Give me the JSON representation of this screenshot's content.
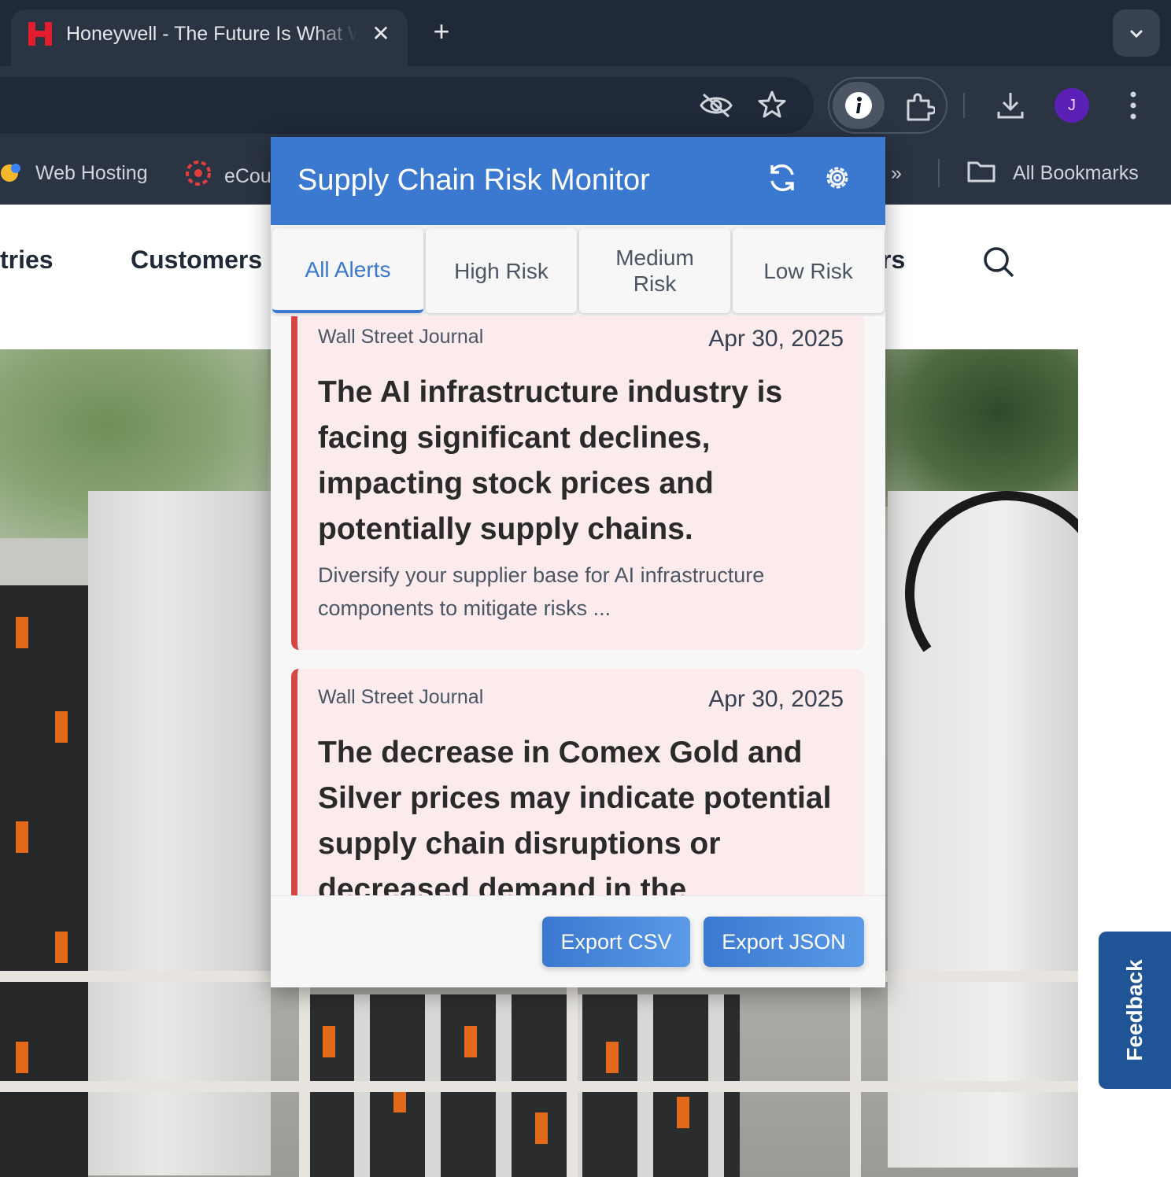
{
  "browser": {
    "tab_title": "Honeywell - The Future Is What We Make It",
    "favicon_letter": "H",
    "avatar_initial": "J",
    "bookmarks": [
      {
        "label": "Web Hosting"
      },
      {
        "label": "eCou"
      }
    ],
    "all_bookmarks_label": "All Bookmarks",
    "overflow_label": "»"
  },
  "site": {
    "nav": [
      "tries",
      "Customers",
      "rs"
    ],
    "feedback_label": "Feedback"
  },
  "popup": {
    "title": "Supply Chain Risk Monitor",
    "tabs": [
      {
        "label": "All Alerts",
        "active": true
      },
      {
        "label": "High Risk",
        "active": false
      },
      {
        "label": "Medium Risk",
        "active": false
      },
      {
        "label": "Low Risk",
        "active": false
      }
    ],
    "alerts": [
      {
        "source": "Wall Street Journal",
        "date": "Apr 30, 2025",
        "title": "The AI infrastructure industry is facing significant declines, impacting stock prices and potentially supply chains.",
        "recommendation": "Diversify your supplier base for AI infrastructure components to mitigate risks ..."
      },
      {
        "source": "Wall Street Journal",
        "date": "Apr 30, 2025",
        "title": "The decrease in Comex Gold and Silver prices may indicate potential supply chain disruptions or decreased demand in the",
        "recommendation": ""
      }
    ],
    "export_csv_label": "Export CSV",
    "export_json_label": "Export JSON"
  },
  "colors": {
    "accent": "#3b78d0",
    "alert_high": "#d64545",
    "alert_bg": "#fcebec",
    "feedback": "#1f5597"
  }
}
